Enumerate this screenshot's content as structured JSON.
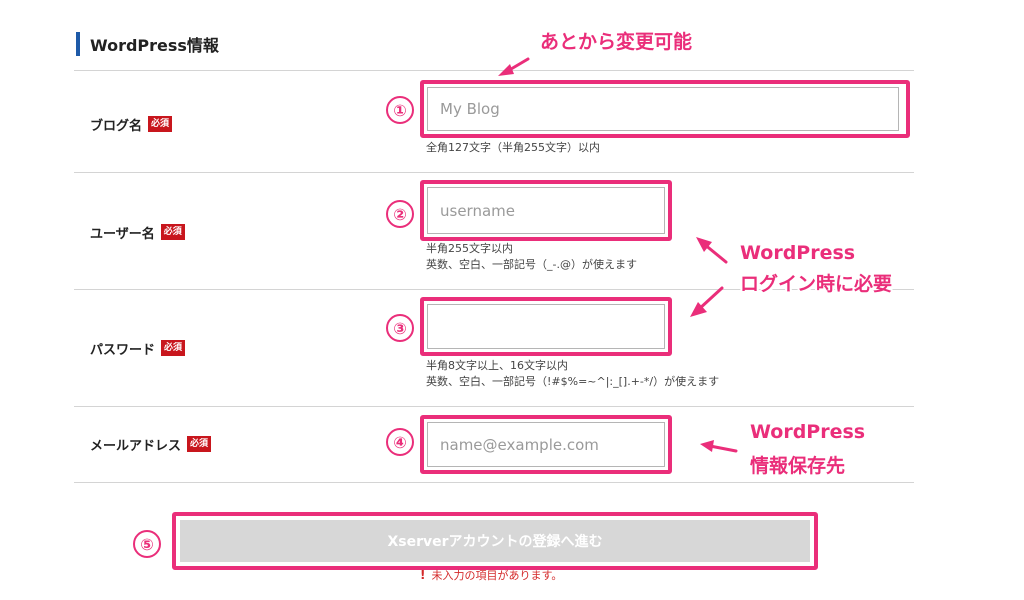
{
  "section": {
    "title": "WordPress情報"
  },
  "required_badge": "必須",
  "fields": [
    {
      "label": "ブログ名",
      "number": "①",
      "value": "",
      "placeholder": "My Blog",
      "hints": [
        "全角127文字（半角255文字）以内"
      ]
    },
    {
      "label": "ユーザー名",
      "number": "②",
      "value": "",
      "placeholder": "username",
      "hints": [
        "半角255文字以内",
        "英数、空白、一部記号（_-.@）が使えます"
      ]
    },
    {
      "label": "パスワード",
      "number": "③",
      "value": "",
      "placeholder": "",
      "hints": [
        "半角8文字以上、16文字以内",
        "英数、空白、一部記号（!#$%=~^|:_[].+-*/）が使えます"
      ]
    },
    {
      "label": "メールアドレス",
      "number": "④",
      "value": "",
      "placeholder": "name@example.com",
      "hints": []
    }
  ],
  "submit": {
    "number": "⑤",
    "label": "Xserverアカウントの登録へ進む"
  },
  "error": {
    "icon": "!",
    "message": "未入力の項目があります。"
  },
  "annotations": {
    "changeable": "あとから変更可能",
    "login_line1": "WordPress",
    "login_line2": "ログイン時に必要",
    "info_line1": "WordPress",
    "info_line2": "情報保存先"
  },
  "colors": {
    "accent": "#ea2e7a",
    "required": "#c8161d",
    "section_bar": "#1e5aa8",
    "button_disabled": "#d7d7d7"
  }
}
